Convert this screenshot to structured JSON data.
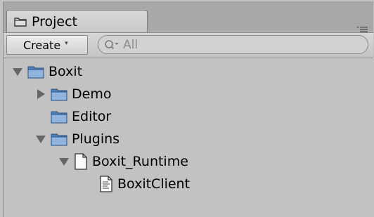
{
  "tab": {
    "title": "Project"
  },
  "toolbar": {
    "create_label": "Create",
    "create_caret": "▾",
    "search_placeholder": "All"
  },
  "tree": {
    "items": [
      {
        "label": "Boxit",
        "icon": "folder-icon",
        "expanded": true,
        "level": 0
      },
      {
        "label": "Demo",
        "icon": "folder-icon",
        "expanded": false,
        "level": 1
      },
      {
        "label": "Editor",
        "icon": "folder-icon",
        "level": 1
      },
      {
        "label": "Plugins",
        "icon": "folder-icon",
        "expanded": true,
        "level": 1
      },
      {
        "label": "Boxit_Runtime",
        "icon": "file-icon",
        "expanded": true,
        "level": 2
      },
      {
        "label": "BoxitClient",
        "icon": "script-file-icon",
        "level": 3
      }
    ]
  },
  "colors": {
    "background": "#c2c2c2",
    "folder_blue": "#4f81bd",
    "folder_light": "#8fb4de"
  }
}
